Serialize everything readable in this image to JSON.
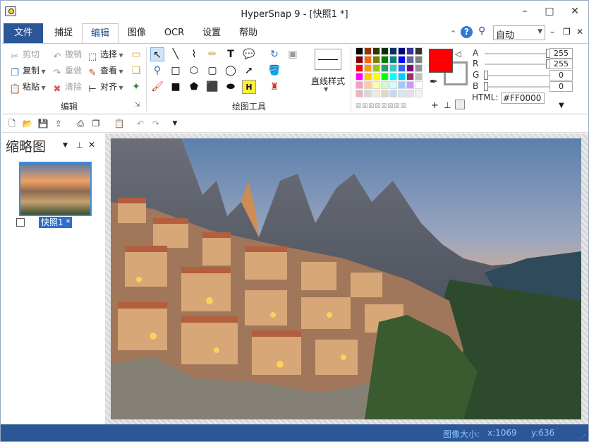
{
  "window": {
    "title": "HyperSnap 9 - [快照1 *]",
    "minimize": "–",
    "maximize": "□",
    "close": "✕"
  },
  "tabs": [
    {
      "label": "文件"
    },
    {
      "label": "捕捉"
    },
    {
      "label": "编辑"
    },
    {
      "label": "图像"
    },
    {
      "label": "OCR"
    },
    {
      "label": "设置"
    },
    {
      "label": "帮助"
    }
  ],
  "tabbar_right": {
    "zoom_value": "自动",
    "restore": "–",
    "float": "❐",
    "close": "✕"
  },
  "ribbon": {
    "edit_group": {
      "label": "编辑",
      "cut": "剪切",
      "copy": "复制",
      "paste": "粘贴",
      "undo": "撤销",
      "redo": "重做",
      "clear": "清除",
      "select": "选择",
      "view": "查看",
      "align": "对齐"
    },
    "draw_group": {
      "label": "绘图工具",
      "line_style": "直线样式"
    },
    "color": {
      "selected_hex": "#FF0000",
      "A": "255",
      "R": "255",
      "G": "0",
      "B": "0",
      "A_label": "A",
      "R_label": "R",
      "G_label": "G",
      "B_label": "B",
      "html_label": "HTML:",
      "html_value": "#FF0000"
    },
    "palette": [
      [
        "#000000",
        "#993300",
        "#333300",
        "#003300",
        "#003366",
        "#000080",
        "#333399",
        "#333333"
      ],
      [
        "#800000",
        "#ff6600",
        "#808000",
        "#008000",
        "#008080",
        "#0000ff",
        "#666699",
        "#808080"
      ],
      [
        "#ff0000",
        "#ff9900",
        "#99cc00",
        "#339966",
        "#33cccc",
        "#3366ff",
        "#800080",
        "#969696"
      ],
      [
        "#ff00ff",
        "#ffcc00",
        "#ffff00",
        "#00ff00",
        "#00ffff",
        "#00ccff",
        "#993366",
        "#c0c0c0"
      ],
      [
        "#ff99cc",
        "#ffcc99",
        "#ffff99",
        "#ccffcc",
        "#ccffff",
        "#99ccff",
        "#cc99ff",
        "#ffffff"
      ],
      [
        "#e6b8b7",
        "#d8d8d8",
        "#eeece1",
        "#ddd9c3",
        "#c6d9f0",
        "#dbe5f1",
        "#e5e0ec",
        "#f2f2f2"
      ]
    ]
  },
  "side_panel": {
    "title": "缩略图",
    "thumb_label": "快照1 *"
  },
  "status": {
    "size_label": "图像大小:",
    "x": "x:1069",
    "y": "y:636"
  },
  "colors": {
    "accent": "#2b5797",
    "status_text": "#8fc4ff"
  }
}
